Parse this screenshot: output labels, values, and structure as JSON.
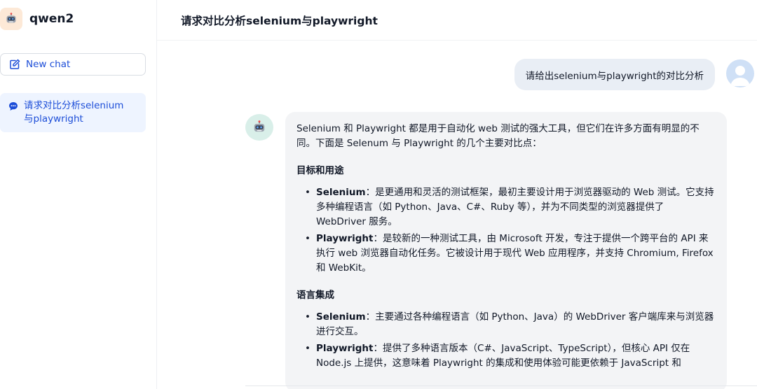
{
  "app": {
    "name": "qwen2"
  },
  "sidebar": {
    "new_chat_label": "New chat",
    "conversations": [
      {
        "label": "请求对比分析selenium与playwright"
      }
    ]
  },
  "header": {
    "title": "请求对比分析selenium与playwright"
  },
  "messages": {
    "user": "请给出selenium与playwright的对比分析",
    "assistant": {
      "intro": "Selenium 和 Playwright 都是用于自动化 web 测试的强大工具，但它们在许多方面有明显的不同。下面是 Selenum 与 Playwright 的几个主要对比点：",
      "sections": [
        {
          "heading": "目标和用途",
          "items": [
            {
              "term": "Selenium",
              "text": "：是更通用和灵活的测试框架，最初主要设计用于浏览器驱动的 Web 测试。它支持多种编程语言（如 Python、Java、C#、Ruby 等），并为不同类型的浏览器提供了 WebDriver 服务。"
            },
            {
              "term": "Playwright",
              "text": "：是较新的一种测试工具，由 Microsoft 开发，专注于提供一个跨平台的 API 来执行 web 浏览器自动化任务。它被设计用于现代 Web 应用程序，并支持 Chromium, Firefox 和 WebKit。"
            }
          ]
        },
        {
          "heading": "语言集成",
          "items": [
            {
              "term": "Selenium",
              "text": "：主要通过各种编程语言（如 Python、Java）的 WebDriver 客户端库来与浏览器进行交互。"
            },
            {
              "term": "Playwright",
              "text": "：提供了多种语言版本（C#、JavaScript、TypeScript），但核心 API 仅在 Node.js 上提供，这意味着 Playwright 的集成和使用体验可能更依赖于 JavaScript 和"
            }
          ]
        }
      ]
    }
  },
  "icons": {
    "brand": "robot-icon",
    "new_chat": "edit-icon",
    "conversation": "chat-bubble-icon",
    "user_avatar": "user-avatar-icon",
    "bot_avatar": "robot-icon"
  },
  "colors": {
    "accent": "#1d4ed8",
    "active_item_bg": "#eef4ff",
    "user_bubble_bg": "#e9eef5",
    "bot_bubble_bg": "#f3f4f6",
    "user_avatar_bg": "#cfe0f6",
    "bot_avatar_bg": "#d9efe9",
    "brand_avatar_bg": "#fde9d7"
  }
}
